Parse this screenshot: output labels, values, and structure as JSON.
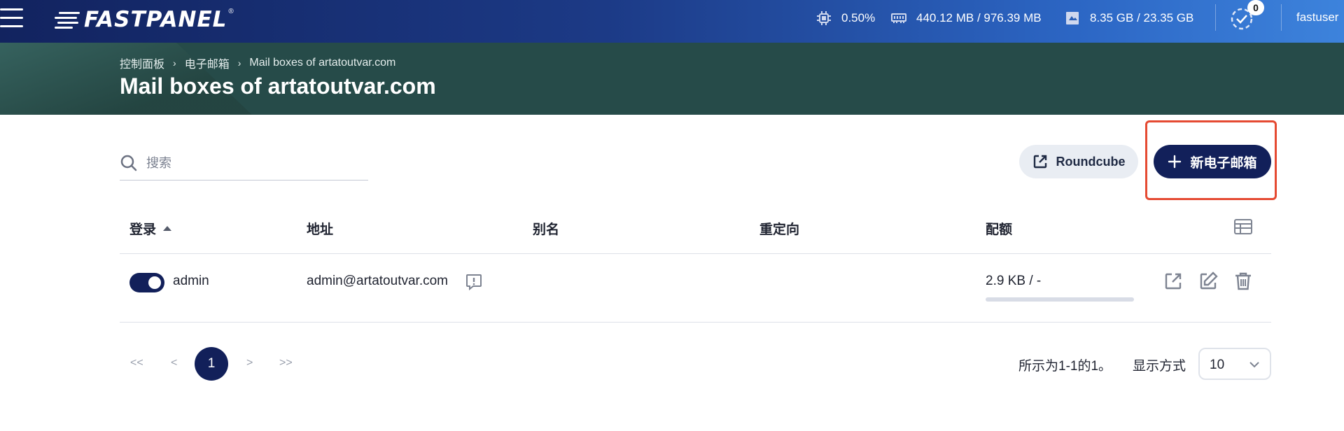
{
  "topbar": {
    "brand": "FASTPANEL",
    "brand_mark": "®",
    "cpu": "0.50%",
    "memory": "440.12 MB / 976.39 MB",
    "disk": "8.35 GB / 23.35 GB",
    "tasks_badge": "0",
    "user": "fastuser"
  },
  "breadcrumb": [
    "控制面板",
    "电子邮箱",
    "Mail boxes of artatoutvar.com"
  ],
  "breadcrumb_sep": "›",
  "page_title": "Mail boxes of artatoutvar.com",
  "search": {
    "placeholder": "搜索",
    "value": ""
  },
  "buttons": {
    "roundcube": "Roundcube",
    "new_mailbox": "新电子邮箱"
  },
  "table": {
    "columns": [
      "登录",
      "地址",
      "别名",
      "重定向",
      "配额"
    ],
    "rows": [
      {
        "login": "admin",
        "enabled": true,
        "address": "admin@artatoutvar.com",
        "alias": "",
        "redirect": "",
        "quota": "2.9 KB / -"
      }
    ]
  },
  "pagination": {
    "first": "<<",
    "prev": "<",
    "current": "1",
    "next": ">",
    "last": ">>",
    "info": "所示为1-1的1。",
    "per_page_label": "显示方式",
    "per_page": "10"
  },
  "colors": {
    "primary": "#12205a",
    "highlight": "#e54a32",
    "hero": "#264b49"
  }
}
